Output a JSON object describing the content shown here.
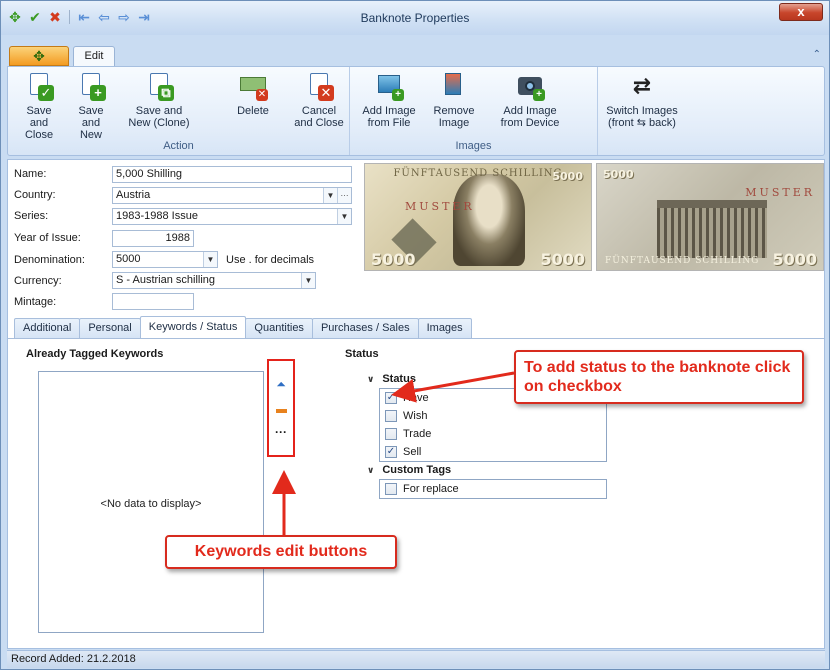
{
  "window": {
    "title": "Banknote Properties",
    "close_glyph": "x"
  },
  "quick_access": {
    "icons": [
      "add-green-icon",
      "check-icon",
      "cancel-icon",
      "first-icon",
      "back-icon",
      "forward-icon",
      "last-icon"
    ]
  },
  "ribbon": {
    "app_button_glyph": "✥",
    "tab_edit": "Edit",
    "collapse_glyph": "⌃",
    "groups": {
      "action": "Action",
      "images": "Images"
    },
    "buttons": {
      "save_close": "Save and\nClose",
      "save_new": "Save and\nNew",
      "save_new_clone": "Save and\nNew (Clone)",
      "delete": "Delete",
      "cancel_close": "Cancel\nand Close",
      "add_image_file": "Add Image\nfrom File",
      "remove_image": "Remove\nImage",
      "add_image_device": "Add Image\nfrom Device",
      "switch_images": "Switch Images\n(front ⇆ back)"
    }
  },
  "form": {
    "name_label": "Name:",
    "name_value": "5,000 Shilling",
    "country_label": "Country:",
    "country_value": "Austria",
    "series_label": "Series:",
    "series_value": "1983-1988 Issue",
    "year_label": "Year of Issue:",
    "year_value": "1988",
    "denomination_label": "Denomination:",
    "denomination_value": "5000",
    "decimals_hint": "Use . for decimals",
    "currency_label": "Currency:",
    "currency_value": "S - Austrian schilling",
    "mintage_label": "Mintage:",
    "mintage_value": ""
  },
  "banknote": {
    "front_header": "FÜNFTAUSEND SCHILLING",
    "front_value": "5000",
    "muster": "MUSTER",
    "back_value": "5000",
    "back_footer": "FÜNFTAUSEND SCHILLING"
  },
  "tabs": [
    "Additional",
    "Personal",
    "Keywords / Status",
    "Quantities",
    "Purchases / Sales",
    "Images"
  ],
  "keywords": {
    "title": "Already Tagged Keywords",
    "empty_text": "<No data to display>"
  },
  "status": {
    "title": "Status",
    "groups": [
      {
        "name": "Status",
        "items": [
          {
            "label": "Have",
            "checked": true
          },
          {
            "label": "Wish",
            "checked": false
          },
          {
            "label": "Trade",
            "checked": false
          },
          {
            "label": "Sell",
            "checked": true
          }
        ]
      },
      {
        "name": "Custom Tags",
        "items": [
          {
            "label": "For replace",
            "checked": false
          }
        ]
      }
    ]
  },
  "annotations": {
    "status_callout": "To add status to the banknote click on checkbox",
    "keywords_callout": "Keywords edit buttons"
  },
  "statusbar": {
    "text": "Record Added: 21.2.2018"
  },
  "colors": {
    "callout_red": "#e22a1c",
    "ribbon_bg": "#e3edf9",
    "frame_blue": "#c9dcf2"
  }
}
